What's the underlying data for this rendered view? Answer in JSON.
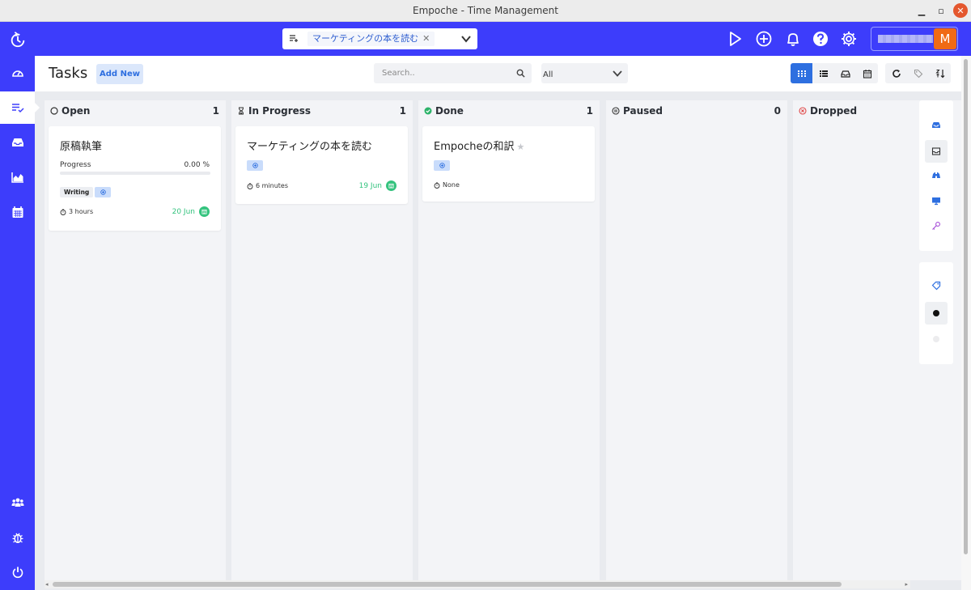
{
  "window": {
    "title": "Empoche - Time Management"
  },
  "header": {
    "task_select": {
      "selected": "マーケティングの本を読む",
      "clear": "✕"
    },
    "icons": [
      "play-icon",
      "plus-circle-icon",
      "bell-icon",
      "help-icon",
      "gear-icon"
    ],
    "user": {
      "avatar_letter": "M"
    }
  },
  "sidebar": {
    "items": [
      {
        "name": "dashboard-icon"
      },
      {
        "name": "tasks-icon",
        "active": true
      },
      {
        "name": "inbox-icon"
      },
      {
        "name": "reports-chart-icon"
      },
      {
        "name": "calendar-icon"
      },
      {
        "name": "team-icon"
      },
      {
        "name": "bug-icon"
      },
      {
        "name": "power-icon"
      }
    ]
  },
  "toolbar": {
    "title": "Tasks",
    "add_new": "Add New",
    "search_placeholder": "Search..",
    "filter_value": "All",
    "view_buttons": [
      "board-view-icon",
      "list-view-icon",
      "inbox-view-icon",
      "calendar-view-icon",
      "refresh-icon",
      "tags-icon",
      "sort-icon"
    ],
    "accent": "#2E6FE0"
  },
  "columns": [
    {
      "name": "Open",
      "count": "1",
      "cards": [
        {
          "title": "原稿執筆",
          "progress_label": "Progress",
          "progress_value": "0.00 %",
          "progress_fraction": 0,
          "tag": "Writing",
          "duration": "3 hours",
          "due": "20 Jun"
        }
      ]
    },
    {
      "name": "In Progress",
      "count": "1",
      "cards": [
        {
          "title": "マーケティングの本を読む",
          "duration": "6 minutes",
          "due": "19 Jun"
        }
      ]
    },
    {
      "name": "Done",
      "count": "1",
      "cards": [
        {
          "title": "Empocheの和訳",
          "duration": "None",
          "starred": true
        }
      ]
    },
    {
      "name": "Paused",
      "count": "0",
      "cards": []
    },
    {
      "name": "Dropped",
      "count": "",
      "cards": []
    }
  ],
  "right_panel": {
    "top": [
      "inbox-icon",
      "inbox-outline-icon",
      "binoculars-icon",
      "monitor-icon",
      "key-icon"
    ],
    "bottom": [
      "tag-icon",
      "black-dot",
      "gray-dot"
    ]
  },
  "colors": {
    "brand": "#3D3DFB",
    "due_green": "#34C37E",
    "done_green": "#2DB36A",
    "dropped_red": "#E04848",
    "avatar": "#F06A15"
  }
}
